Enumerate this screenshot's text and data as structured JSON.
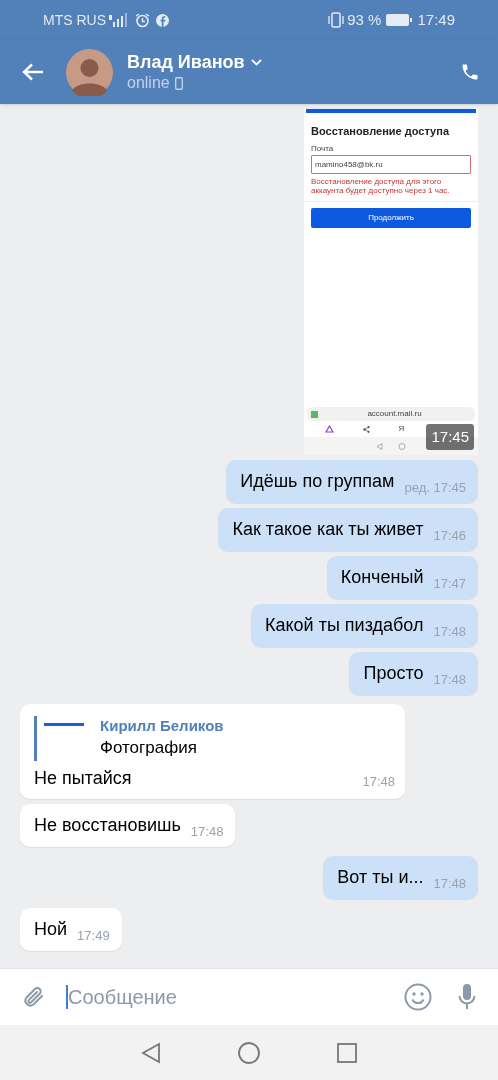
{
  "status_bar": {
    "carrier": "MTS RUS",
    "battery": "93 %",
    "time": "17:49"
  },
  "header": {
    "name": "Влад Иванов",
    "status": "online"
  },
  "messages": [
    {
      "kind": "image",
      "time": "17:45",
      "screenshot": {
        "title": "Восстановление доступа",
        "field_label": "Почта",
        "field_value": "mamino458@bk.ru",
        "error": "Восстановление доступа для этого аккаунта будет доступно через 1 час.",
        "button": "Продолжить",
        "url": "account.mail.ru",
        "toolbar_letter": "Я"
      }
    },
    {
      "kind": "text",
      "outgoing": true,
      "text": "Идёшь по группам",
      "edited_label": "ред.",
      "time": "17:45"
    },
    {
      "kind": "text",
      "outgoing": true,
      "text": "Как такое как ты живет",
      "time": "17:46"
    },
    {
      "kind": "text",
      "outgoing": true,
      "text": "Конченый",
      "time": "17:47"
    },
    {
      "kind": "text",
      "outgoing": true,
      "text": "Какой ты пиздабол",
      "time": "17:48"
    },
    {
      "kind": "text",
      "outgoing": true,
      "text": "Просто",
      "time": "17:48"
    },
    {
      "kind": "reply",
      "outgoing": false,
      "quote_author": "Кирилл Беликов",
      "quote_text": "Фотография",
      "text": "Не пытайся",
      "time": "17:48"
    },
    {
      "kind": "text",
      "outgoing": false,
      "text": "Не восстановишь",
      "time": "17:48"
    },
    {
      "kind": "text",
      "outgoing": true,
      "text": "Вот ты и...",
      "time": "17:48"
    },
    {
      "kind": "text",
      "outgoing": false,
      "text": "Ной",
      "time": "17:49"
    }
  ],
  "composer": {
    "placeholder": "Сообщение"
  }
}
